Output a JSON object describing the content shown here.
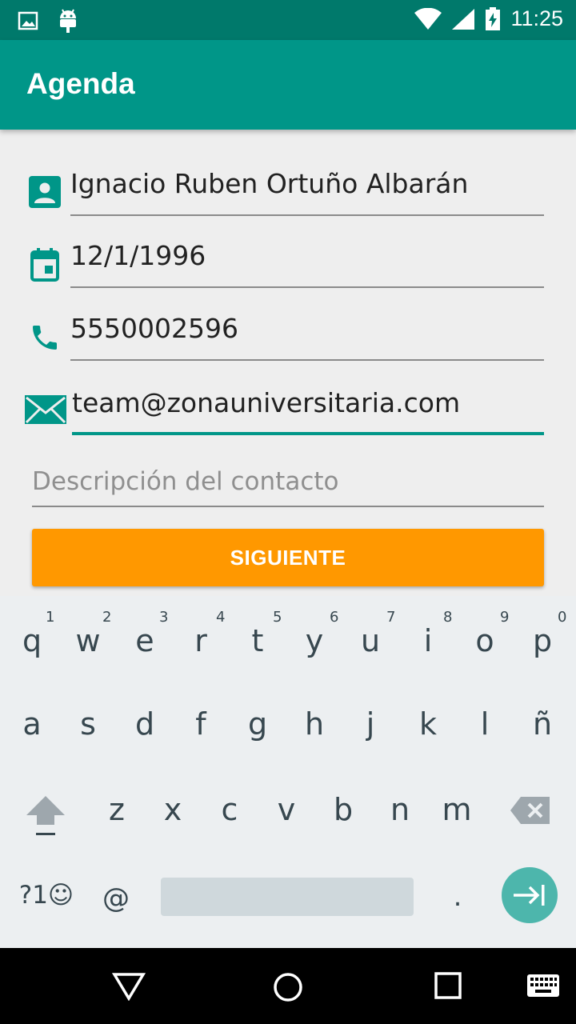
{
  "status_bar": {
    "time": "11:25",
    "icons": [
      "image-icon",
      "android-icon",
      "wifi-icon",
      "signal-icon",
      "battery-charging-icon"
    ]
  },
  "app_bar": {
    "title": "Agenda"
  },
  "form": {
    "name": {
      "value": "Ignacio Ruben Ortuño Albarán",
      "icon": "person-icon"
    },
    "date": {
      "value": "12/1/1996",
      "icon": "calendar-icon"
    },
    "phone": {
      "value": "5550002596",
      "icon": "phone-icon"
    },
    "email": {
      "value": "team@zonauniversitaria.com",
      "icon": "mail-icon"
    },
    "description": {
      "placeholder": "Descripción del contacto"
    },
    "next_button": "SIGUIENTE"
  },
  "colors": {
    "status_bar": "#00796b",
    "app_bar": "#009688",
    "accent": "#009688",
    "button": "#ff9800"
  },
  "keyboard": {
    "row1": [
      "q",
      "w",
      "e",
      "r",
      "t",
      "y",
      "u",
      "i",
      "o",
      "p"
    ],
    "row1_numbers": [
      "1",
      "2",
      "3",
      "4",
      "5",
      "6",
      "7",
      "8",
      "9",
      "0"
    ],
    "row2": [
      "a",
      "s",
      "d",
      "f",
      "g",
      "h",
      "j",
      "k",
      "l",
      "ñ"
    ],
    "row3": [
      "z",
      "x",
      "c",
      "v",
      "b",
      "n",
      "m"
    ],
    "symbols_key": "?1☺",
    "at_key": "@",
    "period_key": "."
  },
  "nav_bar": {
    "icons": [
      "back-icon",
      "home-icon",
      "recents-icon",
      "keyboard-icon"
    ]
  }
}
